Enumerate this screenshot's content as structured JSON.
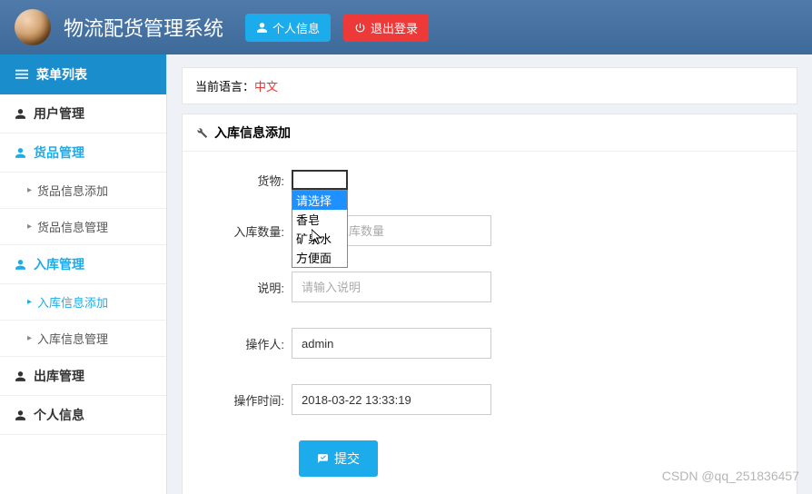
{
  "header": {
    "app_title": "物流配货管理系统",
    "profile_btn": "个人信息",
    "logout_btn": "退出登录"
  },
  "sidebar": {
    "menu_title": "菜单列表",
    "items": [
      {
        "label": "用户管理"
      },
      {
        "label": "货品管理",
        "children": [
          {
            "label": "货品信息添加"
          },
          {
            "label": "货品信息管理"
          }
        ]
      },
      {
        "label": "入库管理",
        "children": [
          {
            "label": "入库信息添加"
          },
          {
            "label": "入库信息管理"
          }
        ]
      },
      {
        "label": "出库管理"
      },
      {
        "label": "个人信息"
      }
    ]
  },
  "lang": {
    "label": "当前语言：",
    "value": "中文"
  },
  "panel": {
    "title": "入库信息添加"
  },
  "form": {
    "goods_label": "货物:",
    "goods_options": [
      "请选择",
      "香皂",
      "矿泉水",
      "方便面"
    ],
    "qty_label": "入库数量:",
    "qty_placeholder": "请输入入库数量",
    "desc_label": "说明:",
    "desc_placeholder": "请输入说明",
    "operator_label": "操作人:",
    "operator_value": "admin",
    "time_label": "操作时间:",
    "time_value": "2018-03-22 13:33:19",
    "submit": "提交"
  },
  "watermark": "CSDN @qq_251836457"
}
